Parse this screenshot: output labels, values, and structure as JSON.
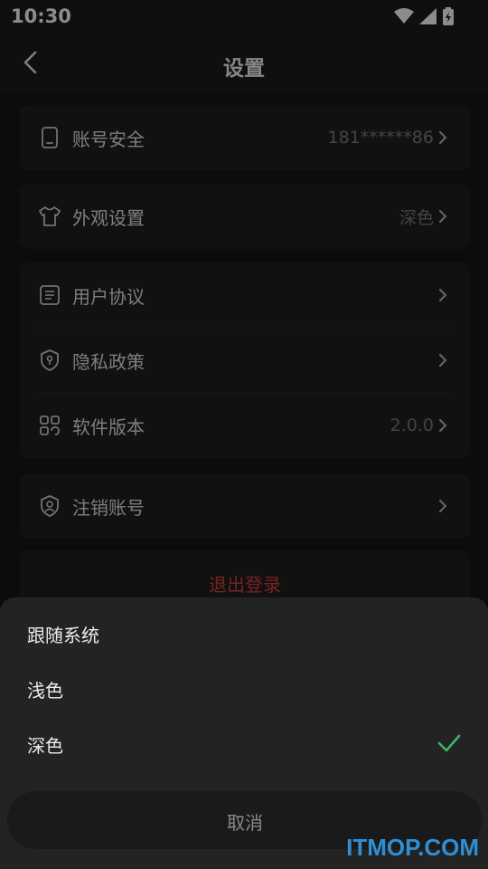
{
  "status_bar": {
    "time": "10:30",
    "icons": [
      "wifi-icon",
      "signal-icon",
      "battery-icon"
    ]
  },
  "header": {
    "title": "设置"
  },
  "settings": {
    "account": {
      "label": "账号安全",
      "value": "181******86",
      "icon": "phone-icon"
    },
    "appearance": {
      "label": "外观设置",
      "value": "深色",
      "icon": "shirt-icon"
    },
    "agreement": {
      "label": "用户协议",
      "icon": "document-icon"
    },
    "privacy": {
      "label": "隐私政策",
      "icon": "shield-icon"
    },
    "version": {
      "label": "软件版本",
      "value": "2.0.0",
      "icon": "apps-icon"
    },
    "deactivate": {
      "label": "注销账号",
      "icon": "user-shield-icon"
    }
  },
  "logout": {
    "label": "退出登录"
  },
  "theme_sheet": {
    "options": [
      {
        "label": "跟随系统",
        "selected": false
      },
      {
        "label": "浅色",
        "selected": false
      },
      {
        "label": "深色",
        "selected": true
      }
    ],
    "cancel_label": "取消"
  },
  "watermark": {
    "text": "ITMOP.COM"
  },
  "colors": {
    "accent_check": "#3db36a",
    "danger": "#d8413b",
    "background": "#161616",
    "card": "#202020"
  }
}
